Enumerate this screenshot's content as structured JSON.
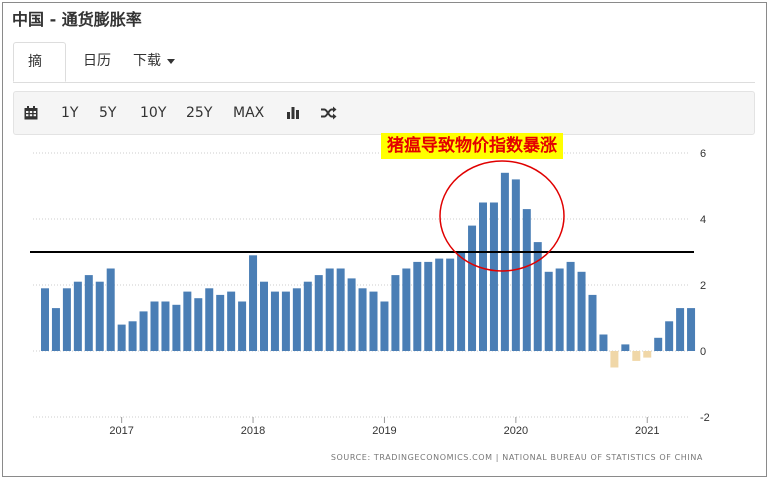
{
  "page": {
    "title": "中国 - 通货膨胀率"
  },
  "tabs": [
    {
      "label": "摘要",
      "active": true
    },
    {
      "label": "日历",
      "active": false
    },
    {
      "label": "下载",
      "active": false
    }
  ],
  "toolbar": {
    "calendar_icon": "calendar-icon",
    "ranges": [
      "1Y",
      "5Y",
      "10Y",
      "25Y",
      "MAX"
    ],
    "chart_type_icon": "bar-chart-icon",
    "shuffle_icon": "shuffle-icon"
  },
  "annotation": {
    "text": "猪瘟导致物价指数暴涨",
    "text_color": "#e40000",
    "highlight_color": "#ffff00",
    "circle_color": "#e00000"
  },
  "source": "SOURCE: TRADINGECONOMICS.COM | NATIONAL BUREAU OF STATISTICS OF CHINA",
  "colors": {
    "positive": "#4a7eb5",
    "negative": "#f0d7a8",
    "reference_line": "#000000",
    "grid": "#cccccc"
  },
  "chart_data": {
    "type": "bar",
    "title": "",
    "xlabel": "",
    "ylabel": "",
    "ylim": [
      -2,
      6
    ],
    "yticks": [
      6,
      4,
      2,
      0,
      -2
    ],
    "year_labels": [
      "2017",
      "2018",
      "2019",
      "2020",
      "2021"
    ],
    "categories": [
      "2016-06",
      "2016-07",
      "2016-08",
      "2016-09",
      "2016-10",
      "2016-11",
      "2016-12",
      "2017-01",
      "2017-02",
      "2017-03",
      "2017-04",
      "2017-05",
      "2017-06",
      "2017-07",
      "2017-08",
      "2017-09",
      "2017-10",
      "2017-11",
      "2017-12",
      "2018-01",
      "2018-02",
      "2018-03",
      "2018-04",
      "2018-05",
      "2018-06",
      "2018-07",
      "2018-08",
      "2018-09",
      "2018-10",
      "2018-11",
      "2018-12",
      "2019-01",
      "2019-02",
      "2019-03",
      "2019-04",
      "2019-05",
      "2019-06",
      "2019-07",
      "2019-08",
      "2019-09",
      "2019-10",
      "2019-11",
      "2019-12",
      "2020-01",
      "2020-02",
      "2020-03",
      "2020-04",
      "2020-05",
      "2020-06",
      "2020-07",
      "2020-08",
      "2020-09",
      "2020-10",
      "2020-11",
      "2020-12",
      "2021-01",
      "2021-02",
      "2021-03",
      "2021-04",
      "2021-05"
    ],
    "values": [
      1.9,
      1.3,
      1.9,
      2.1,
      2.3,
      2.1,
      2.5,
      0.8,
      0.9,
      1.2,
      1.5,
      1.5,
      1.4,
      1.8,
      1.6,
      1.9,
      1.7,
      1.8,
      1.5,
      2.9,
      2.1,
      1.8,
      1.8,
      1.9,
      2.1,
      2.3,
      2.5,
      2.5,
      2.2,
      1.9,
      1.8,
      1.5,
      2.3,
      2.5,
      2.7,
      2.7,
      2.8,
      2.8,
      3.0,
      3.8,
      4.5,
      4.5,
      5.4,
      5.2,
      4.3,
      3.3,
      2.4,
      2.5,
      2.7,
      2.4,
      1.7,
      0.5,
      -0.5,
      0.2,
      -0.3,
      -0.2,
      0.4,
      0.9,
      1.3,
      1.3
    ],
    "reference_line": 3.0,
    "grid": true
  }
}
